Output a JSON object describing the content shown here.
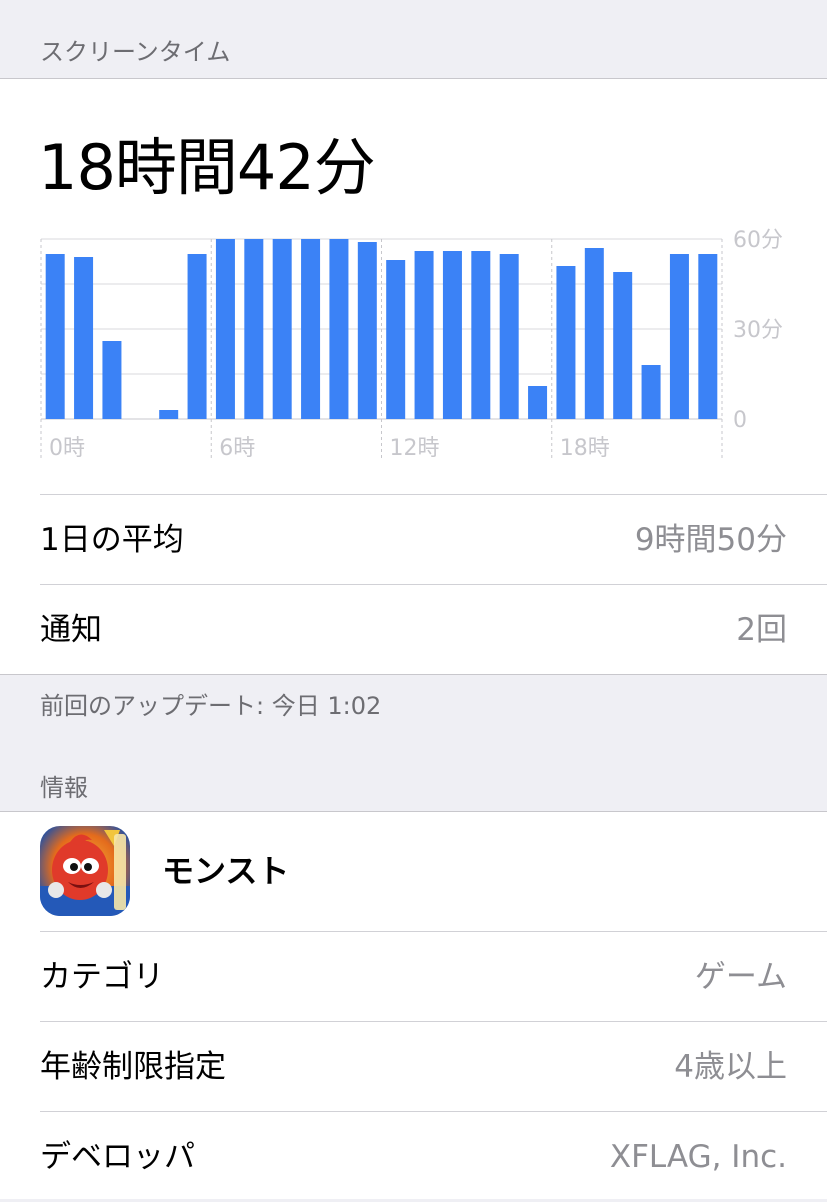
{
  "screen_time": {
    "header": "スクリーンタイム",
    "total": "18時間42分"
  },
  "chart_data": {
    "type": "bar",
    "categories": [
      "0",
      "1",
      "2",
      "3",
      "4",
      "5",
      "6",
      "7",
      "8",
      "9",
      "10",
      "11",
      "12",
      "13",
      "14",
      "15",
      "16",
      "17",
      "18",
      "19",
      "20",
      "21",
      "22",
      "23"
    ],
    "values": [
      55,
      54,
      26,
      0,
      3,
      55,
      60,
      60,
      60,
      60,
      60,
      59,
      53,
      56,
      56,
      56,
      55,
      11,
      51,
      57,
      49,
      18,
      55,
      55
    ],
    "ylim": [
      0,
      60
    ],
    "y_ticks": [
      "60分",
      "30分",
      "0"
    ],
    "x_ticks": [
      "0時",
      "6時",
      "12時",
      "18時"
    ],
    "bar_color": "#3b82f6",
    "grid": true
  },
  "stats": {
    "average_label": "1日の平均",
    "average_value": "9時間50分",
    "notifications_label": "通知",
    "notifications_value": "2回"
  },
  "update_note": "前回のアップデート: 今日 1:02",
  "info": {
    "header": "情報",
    "app_name": "モンスト",
    "app_icon": "monster-strike-app-icon",
    "rows": [
      {
        "label": "カテゴリ",
        "value": "ゲーム"
      },
      {
        "label": "年齢制限指定",
        "value": "4歳以上"
      },
      {
        "label": "デベロッパ",
        "value": "XFLAG, Inc."
      }
    ]
  }
}
